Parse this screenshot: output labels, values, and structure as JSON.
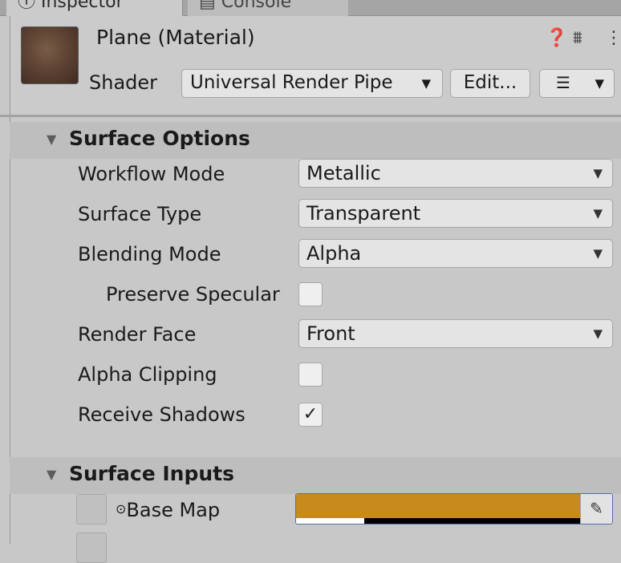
{
  "tabs": [
    {
      "label": "Inspector",
      "icon": "info-icon"
    },
    {
      "label": "Console",
      "icon": "console-icon"
    }
  ],
  "material": {
    "title": "Plane (Material)",
    "shader_label": "Shader",
    "shader_value": "Universal Render Pipe",
    "edit_label": "Edit...",
    "icons": [
      "help-icon",
      "preset-icon",
      "more-icon"
    ]
  },
  "surface_options": {
    "title": "Surface Options",
    "workflow_mode": {
      "label": "Workflow Mode",
      "value": "Metallic"
    },
    "surface_type": {
      "label": "Surface Type",
      "value": "Transparent"
    },
    "blending_mode": {
      "label": "Blending Mode",
      "value": "Alpha"
    },
    "preserve_specular": {
      "label": "Preserve Specular",
      "checked": false
    },
    "render_face": {
      "label": "Render Face",
      "value": "Front"
    },
    "alpha_clipping": {
      "label": "Alpha Clipping",
      "checked": false
    },
    "receive_shadows": {
      "label": "Receive Shadows",
      "checked": true,
      "mark": "✓"
    }
  },
  "surface_inputs": {
    "title": "Surface Inputs",
    "base_map": {
      "label": "Base Map",
      "color": "#c88a1c",
      "alpha": 0.24
    }
  },
  "colors": {
    "accent": "#c88a1c",
    "panel": "#c8c8c8",
    "section_header": "#bebebe"
  }
}
